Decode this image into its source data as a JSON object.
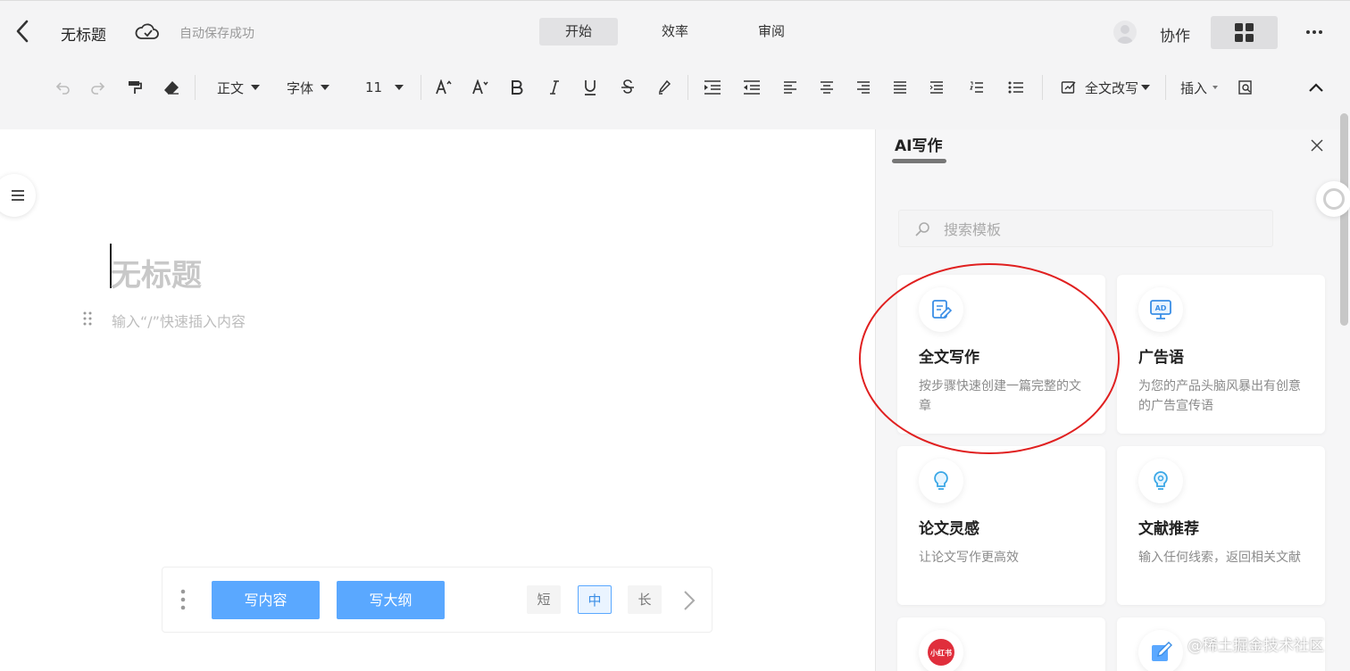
{
  "header": {
    "title": "无标题",
    "autosave": "自动保存成功",
    "tabs": [
      {
        "label": "开始",
        "active": true
      },
      {
        "label": "效率",
        "active": false
      },
      {
        "label": "审阅",
        "active": false
      }
    ],
    "collab_label": "协作"
  },
  "toolbar": {
    "style_label": "正文",
    "font_label": "字体",
    "size_label": "11",
    "rewrite_label": "全文改写",
    "insert_label": "插入"
  },
  "doc": {
    "heading_placeholder": "无标题",
    "body_placeholder": "输入“/”快速插入内容"
  },
  "bottom_bar": {
    "write_content": "写内容",
    "write_outline": "写大纲",
    "lengths": [
      {
        "label": "短",
        "active": false
      },
      {
        "label": "中",
        "active": true
      },
      {
        "label": "长",
        "active": false
      }
    ]
  },
  "panel": {
    "title": "AI写作",
    "search_placeholder": "搜索模板",
    "cards": [
      {
        "title": "全文写作",
        "desc": "按步骤快速创建一篇完整的文章",
        "icon": "document-edit-icon"
      },
      {
        "title": "广告语",
        "desc": "为您的产品头脑风暴出有创意的广告宣传语",
        "icon": "ad-monitor-icon"
      },
      {
        "title": "论文灵感",
        "desc": "让论文写作更高效",
        "icon": "lightbulb-icon"
      },
      {
        "title": "文献推荐",
        "desc": "输入任何线索，返回相关文献",
        "icon": "search-bulb-icon"
      },
      {
        "title": "",
        "desc": "",
        "icon": "xiaohongshu-icon",
        "icon_text": "小红书"
      },
      {
        "title": "",
        "desc": "",
        "icon": "pen-icon"
      }
    ]
  },
  "watermark": "@稀土掘金技术社区",
  "colors": {
    "accent": "#5aa8ff",
    "highlight_oval": "#e02020",
    "icon_blue": "#3a8ee6"
  }
}
